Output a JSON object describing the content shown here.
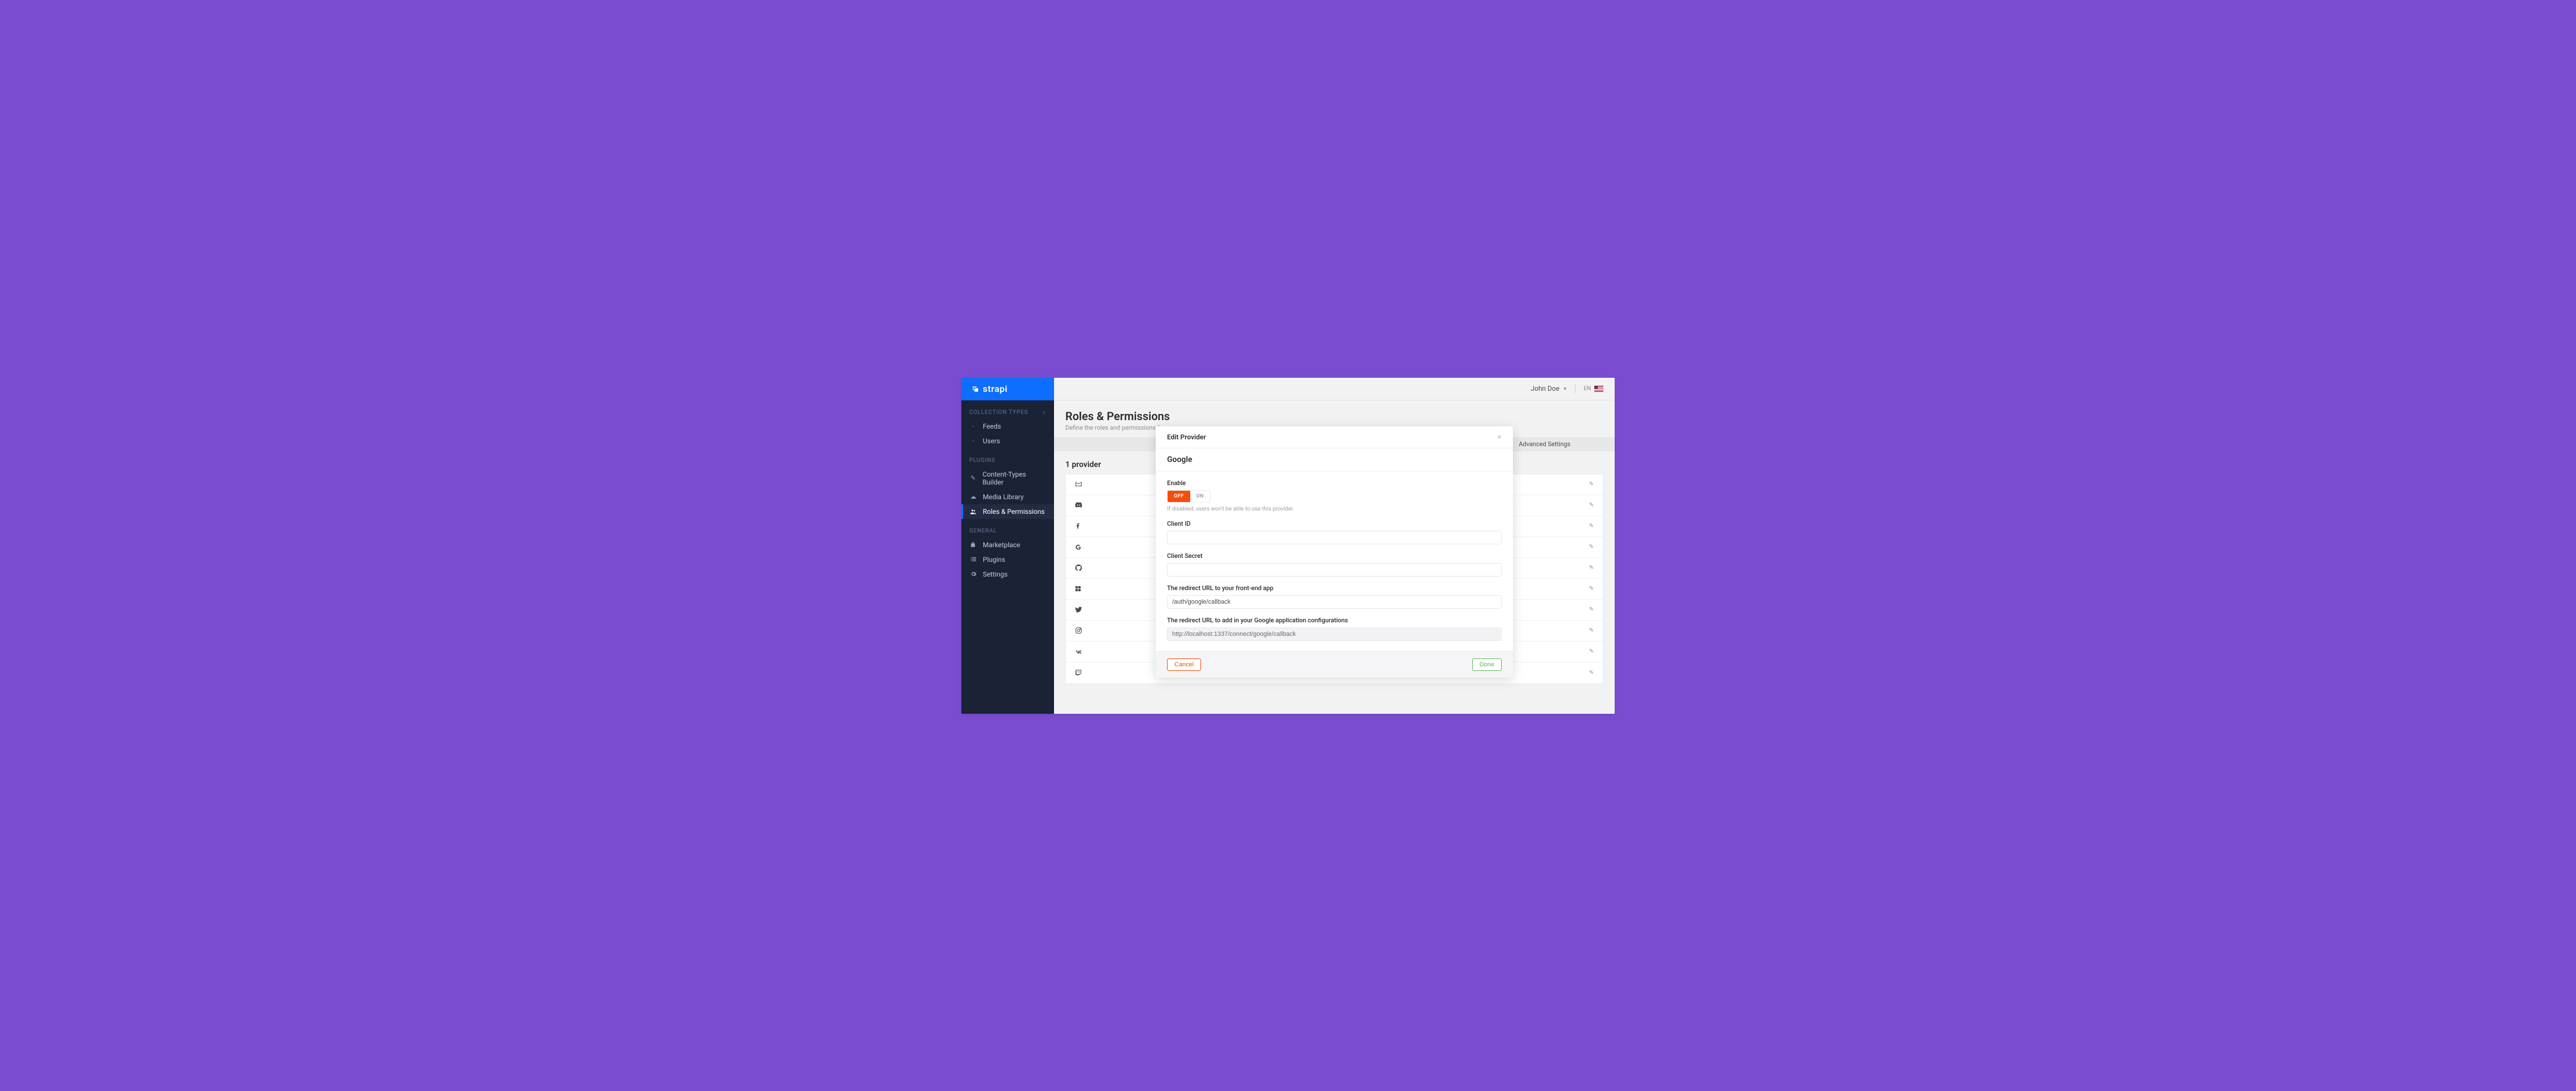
{
  "brand": "strapi",
  "header": {
    "user_name": "John Doe",
    "locale_code": "EN"
  },
  "sidebar": {
    "sections": {
      "collection_types": {
        "label": "COLLECTION TYPES"
      },
      "plugins": {
        "label": "PLUGINS"
      },
      "general": {
        "label": "GENERAL"
      }
    },
    "items": {
      "feeds": "Feeds",
      "users": "Users",
      "content_types_builder": "Content-Types Builder",
      "media_library": "Media Library",
      "roles_permissions": "Roles & Permissions",
      "marketplace": "Marketplace",
      "plugins_item": "Plugins",
      "settings": "Settings"
    }
  },
  "page": {
    "title": "Roles & Permissions",
    "subtitle": "Define the roles and permissions for your users."
  },
  "tabs": {
    "advanced_settings": "Advanced Settings"
  },
  "providers": {
    "heading": "1 provider",
    "items": [
      {
        "icon": "email"
      },
      {
        "icon": "discord"
      },
      {
        "icon": "facebook"
      },
      {
        "icon": "google"
      },
      {
        "icon": "github"
      },
      {
        "icon": "microsoft"
      },
      {
        "icon": "twitter"
      },
      {
        "icon": "instagram"
      },
      {
        "icon": "vk"
      },
      {
        "icon": "twitch"
      }
    ]
  },
  "modal": {
    "title": "Edit Provider",
    "provider_name": "Google",
    "enable": {
      "label": "Enable",
      "off_label": "OFF",
      "on_label": "ON",
      "value": "off",
      "help": "If disabled, users won't be able to use this provider."
    },
    "client_id": {
      "label": "Client ID",
      "value": ""
    },
    "client_secret": {
      "label": "Client Secret",
      "value": ""
    },
    "frontend_redirect": {
      "label": "The redirect URL to your front-end app",
      "value": "/auth/google/callback"
    },
    "backend_redirect": {
      "label": "The redirect URL to add in your Google application configurations",
      "value": "http://localhost:1337/connect/google/callback"
    },
    "cancel_label": "Cancel",
    "done_label": "Done"
  }
}
